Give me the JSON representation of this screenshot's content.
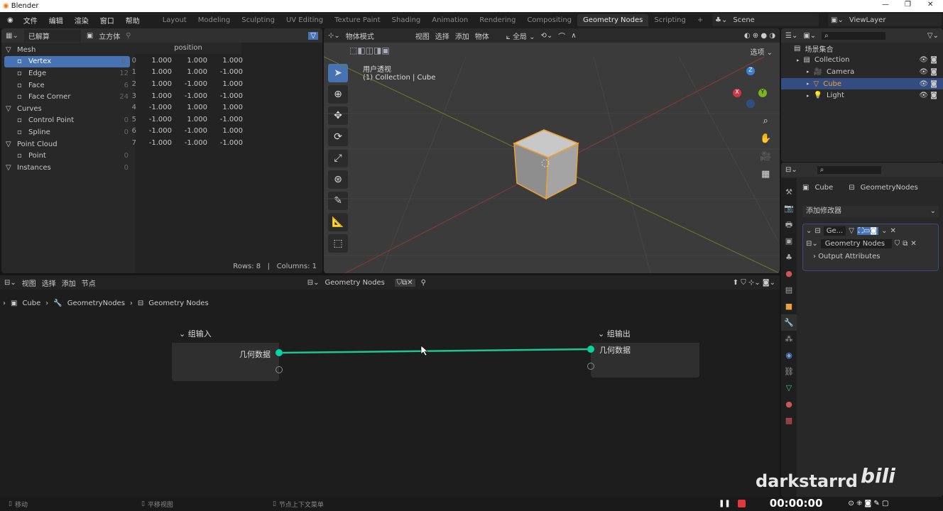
{
  "window": {
    "title": "Blender"
  },
  "menu": [
    "文件",
    "编辑",
    "渲染",
    "窗口",
    "帮助"
  ],
  "workspaces": [
    "Layout",
    "Modeling",
    "Sculpting",
    "UV Editing",
    "Texture Paint",
    "Shading",
    "Animation",
    "Rendering",
    "Compositing",
    "Geometry Nodes",
    "Scripting"
  ],
  "active_workspace": "Geometry Nodes",
  "scene": "Scene",
  "view_layer": "ViewLayer",
  "spreadsheet": {
    "mode": "已解算",
    "object": "立方体",
    "column": "position",
    "tree": [
      {
        "label": "Mesh",
        "count": "",
        "indent": 0
      },
      {
        "label": "Vertex",
        "count": "8",
        "indent": 1,
        "active": true
      },
      {
        "label": "Edge",
        "count": "12",
        "indent": 1
      },
      {
        "label": "Face",
        "count": "6",
        "indent": 1
      },
      {
        "label": "Face Corner",
        "count": "24",
        "indent": 1
      },
      {
        "label": "Curves",
        "count": "",
        "indent": 0
      },
      {
        "label": "Control Point",
        "count": "0",
        "indent": 1
      },
      {
        "label": "Spline",
        "count": "0",
        "indent": 1
      },
      {
        "label": "Point Cloud",
        "count": "",
        "indent": 0
      },
      {
        "label": "Point",
        "count": "0",
        "indent": 1
      },
      {
        "label": "Instances",
        "count": "0",
        "indent": 0
      }
    ],
    "rows": [
      [
        "0",
        "1.000",
        "1.000",
        "1.000"
      ],
      [
        "1",
        "1.000",
        "1.000",
        "-1.000"
      ],
      [
        "2",
        "1.000",
        "-1.000",
        "1.000"
      ],
      [
        "3",
        "1.000",
        "-1.000",
        "-1.000"
      ],
      [
        "4",
        "-1.000",
        "1.000",
        "1.000"
      ],
      [
        "5",
        "-1.000",
        "1.000",
        "-1.000"
      ],
      [
        "6",
        "-1.000",
        "-1.000",
        "1.000"
      ],
      [
        "7",
        "-1.000",
        "-1.000",
        "-1.000"
      ]
    ],
    "rows_label": "Rows: 8",
    "cols_label": "Columns: 1"
  },
  "viewport": {
    "mode": "物体模式",
    "menu": [
      "视图",
      "选择",
      "添加",
      "物体"
    ],
    "orientation": "全局",
    "options": "选项",
    "view_name": "用户透视",
    "collection": "(1) Collection | Cube",
    "gizmo": {
      "z": "Z",
      "y": "Y",
      "x": "X"
    }
  },
  "outliner": {
    "root": "场景集合",
    "items": [
      {
        "label": "Collection",
        "selected": false
      },
      {
        "label": "Camera",
        "selected": false
      },
      {
        "label": "Cube",
        "selected": true
      },
      {
        "label": "Light",
        "selected": false
      }
    ]
  },
  "properties": {
    "object": "Cube",
    "modifier_name": "GeometryNodes",
    "add_modifier": "添加修改器",
    "mod_short": "Ge...",
    "node_group": "Geometry Nodes",
    "output_attributes": "Output Attributes"
  },
  "node_editor": {
    "menu": [
      "视图",
      "选择",
      "添加",
      "节点"
    ],
    "node_group": "Geometry Nodes",
    "breadcrumb": [
      "Cube",
      "GeometryNodes",
      "Geometry Nodes"
    ],
    "group_input": {
      "title": "组输入",
      "socket": "几何数据"
    },
    "group_output": {
      "title": "组输出",
      "socket": "几何数据"
    }
  },
  "statusbar": {
    "items": [
      "移动",
      "平移视图",
      "节点上下文菜单"
    ]
  },
  "recorder": {
    "time": "00:00:00"
  },
  "watermark": {
    "user": "darkstarrd",
    "logo": "bilibili"
  }
}
